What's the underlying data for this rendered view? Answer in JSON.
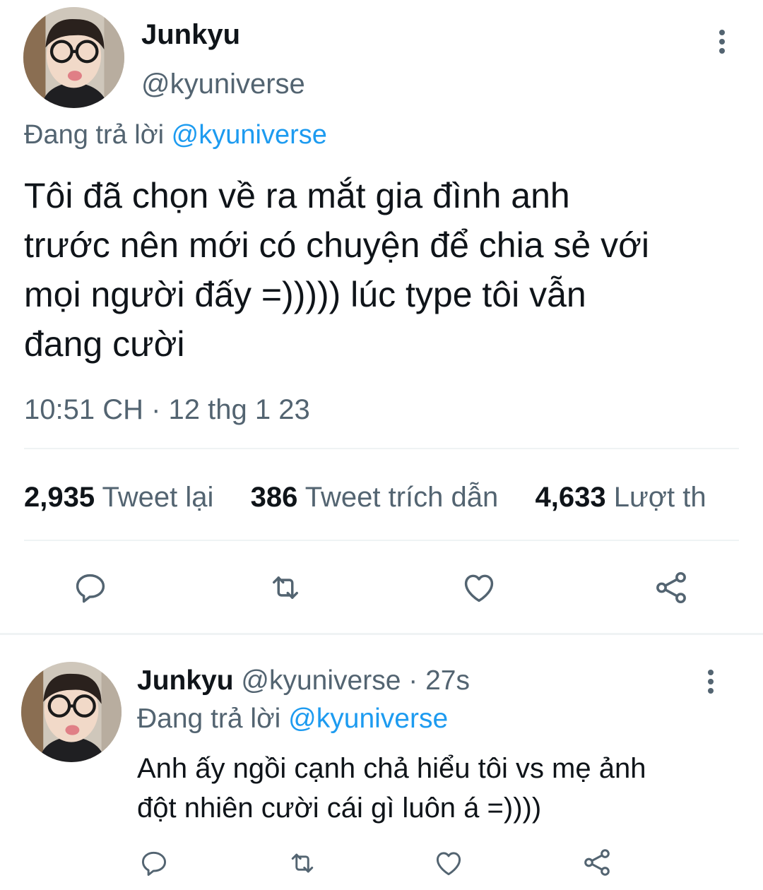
{
  "tweet": {
    "author_name": "Junkyu",
    "author_handle": "@kyuniverse",
    "reply_prefix": "Đang trả lời",
    "reply_handle": "@kyuniverse",
    "text_lines": [
      "Tôi đã chọn về ra mắt gia đình anh",
      "trước nên mới có chuyện để chia sẻ với",
      "mọi người đấy =))))) lúc type tôi vẫn",
      "đang cười"
    ],
    "timestamp": "10:51 CH · 12 thg 1 23",
    "stats": [
      {
        "count": "2,935",
        "label": "Tweet lại"
      },
      {
        "count": "386",
        "label": "Tweet trích dẫn"
      },
      {
        "count": "4,633",
        "label": "Lượt th"
      }
    ],
    "actions": [
      "reply-icon",
      "retweet-icon",
      "like-icon",
      "share-icon"
    ]
  },
  "reply": {
    "author_name": "Junkyu",
    "author_handle": "@kyuniverse",
    "time": "· 27s",
    "reply_prefix": "Đang trả lời",
    "reply_handle": "@kyuniverse",
    "text_lines": [
      "Anh ấy ngồi cạnh chả hiểu tôi vs mẹ ảnh",
      "đột nhiên cười cái gì luôn á =))))"
    ],
    "actions": [
      "reply-icon",
      "retweet-icon",
      "like-icon",
      "share-icon"
    ]
  },
  "colors": {
    "text": "#0f1419",
    "secondary": "#536471",
    "accent": "#1d9bf0",
    "divider": "#eff3f4"
  }
}
